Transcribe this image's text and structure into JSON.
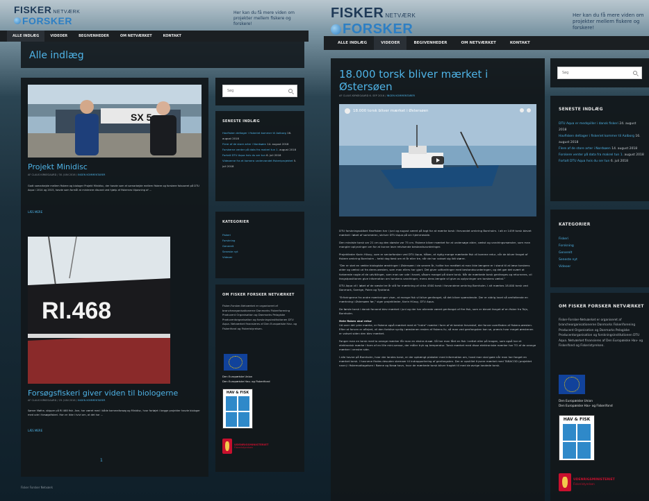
{
  "site": {
    "logo_line1": "FISKER",
    "logo_netvaerk": "NETVÆRK",
    "logo_line2": "FORSKER",
    "tagline": "Her kan du få mere viden om projekter mellem fiskere og forskere!"
  },
  "nav": {
    "items": [
      "ALLE INDLÆG",
      "VIDEOER",
      "BEGIVENHEDER",
      "OM NETVÆRKET",
      "KONTAKT"
    ]
  },
  "left": {
    "page_title": "Alle indlæg",
    "posts": [
      {
        "title": "Projekt Minidisc",
        "meta_prefix": "AF CLAUS KIRKEGAARD / 30. JUNI 2016 /",
        "meta_link": "INGEN KOMMENTARER",
        "excerpt": "Godt samarbejde mellem fiskere og biologer Projekt Minidisc, der havde som et samarbejde mellem fiskere og forskere fokuseret på DTU Aqua i 2014 og 2015, havde som formål at minimere discard ved hjælp af fiskernes tilpasning af ...",
        "read_more": "LÆS MERE",
        "boat_text": "SX 5"
      },
      {
        "title": "Forsøgsfiskeri giver viden til biologerne",
        "meta_prefix": "AF CLAUS KIRKEGAARD / 29. JUNI 2016 /",
        "meta_link": "INGEN KOMMENTARER",
        "excerpt": "Sørner Mølhe, skipper på RI 468 fish. Ane, har været med i både kameraforsøg og Minidisc, hvor fartøjet i begge projekter havde biologer med ude i forsøgsfiskeri. Han er ikke i tvivl om, at det har ...",
        "read_more": "LÆS MERE",
        "boat_text": "RI.468"
      }
    ],
    "pager": "1",
    "footer": "Fisker Forsker Netværk"
  },
  "sidebar": {
    "search_placeholder": "Søg",
    "recent_title": "SENESTE INDLÆG",
    "recent_posts": [
      {
        "link": "Havfisken deltager i fiskeriet kommer til Aalborg",
        "date": "16. august 2018"
      },
      {
        "link": "Flere af de store arter i Nordsøen",
        "date": "14. august 2018"
      },
      {
        "link": "Forskerne venter på data fra makrel tun 1.",
        "date": "august 2018"
      },
      {
        "link": "Fortalt DTU Aqua hvis du ser tun",
        "date": "6. juli 2018"
      },
      {
        "link": "Videoerne fra et kamera undervandet fiskeriprojektet",
        "date": "5. juli 2018"
      }
    ],
    "recent_posts_right": [
      {
        "link": "DTU Aqua er medspiller i dansk fiskeri",
        "date": "24. august 2018"
      },
      {
        "link": "Havfisken deltager i fiskeriet kommer til Aalborg",
        "date": "16. august 2018"
      },
      {
        "link": "Flere af de store arter i Nordsøen",
        "date": "14. august 2018"
      },
      {
        "link": "Forskere venter på data fra makrel tun 1.",
        "date": "august 2018"
      },
      {
        "link": "Fortalt DTU Aqua hvis du ser tun",
        "date": "6. juli 2018"
      }
    ],
    "cat_title": "KATEGORIER",
    "categories": [
      "Fiskeri",
      "Forskning",
      "Generelt",
      "Seneste nyt",
      "Videoer"
    ],
    "about_title": "OM FISKER FORSKER NETVÆRKET",
    "about_text": "Fisker-Forsker-Netværket er organiseret af brancheorganisationerne Danmarks Fiskeriforening Producent Organisation og Danmarks Pelagiske Producentorganisation og forskningsinstitutionen DTU Aqua. Netværket finansieres af Den Europæiske Hav- og Fiskerifond og Fiskeristyrelsen.",
    "eu_line1": "Den Europæiske Union",
    "eu_line2": "Den Europæiske Hav- og Fiskerifond",
    "hav_title": "HAV & FISK",
    "ministry_title": "UDENRIGSMINISTERIET",
    "ministry_sub": "Fiskeristyrelsen"
  },
  "article": {
    "title": "18.000 torsk bliver mærket i Østersøen",
    "meta_prefix": "AF CLAUS KIRKEGAARD 6. SEP 2016 /",
    "meta_link": "INGEN KOMMENTARER",
    "video_title": "18.000 torsk bliver mærket i Østersøen",
    "paragraphs": [
      "DTU forskningsskibet Havfisken har i juni og august været på togt for at mærke torsk i farvandet omkring Bornholm. I alt er 1459 torsk blevet mærket i løbet af sommeren, skriver DTU Aqua på sin hjemmeside.",
      "Den mindste torsk var 21 cm og den største var 75 cm. Fiskene bliver mærket for at undersøge alder, vækst og vandringsmønster, som man mangler oplysninger om for at kunne lave retvisende bestandsvurderinger.",
      "Projektleder Karin Hüssy, som er seniorforsker ved DTU Aqua, håber, at rigtig mange mærkede fisk vil komme retur, når de bliver fanget af fiskere omkring Bornholm – helst dog først om et år eller tre, når de har vokset sig lidt større.",
      "\"Der er sket en række biologiske ændringer i Østersøen i de senere år, hvilke har medført at man ikke længere er i stand til at læse torskens alder og vækst ud fra deres øresten, som man ellers har gjort. Det giver udfordringer med bestandsvurderingen, og det gør det svært at forberede nogle af de udviklinger, som man ser ude i havet, såsom mangel på store torsk. Når de mærkede torsk genfanges og returneres, vil fangstpositionen give information om torskens vandringer, mens dens længde vil give os oplysninger om torskens vækst.\"",
      "DTU Aqua vil i løbet af de næste tre år stå for mærkning af cirka 4500 torsk i farvandene omkring Bornholm. I alt mærkes 18.000 torsk ved Danmark, Sverige, Polen og Tyskland.",
      "\"Erfaringerne fra andre mærkninger viser, at mange fisk vil blive genfanget, så det bliver spændende. Der er aldrig lavet så omfattende en mærkning i Østersøen før,\" siger projektleder, Karin Hüssy, DTU Aqua.",
      "De første torsk i dansk farvand blev mærket i juni og der har allerede været genfangst af fire fisk, som er blevet fanget af en fisker fra Tejn, Bornholm."
    ],
    "subhead": "Hele fisken skal retur",
    "paragraphs2": [
      "Ud over det ydre mærke, er fiskene også mærket med et \"indre\" mærke i form af et kemisk farvestof, der farver overfladen af fiskens øresten. Efter at farven er aflejret, vil den forblive synlig i ørestenen resten af fiskens liv, så man ved genfangsten kan se, præcis hvor meget ørestenen er vokset siden den blev mærket.",
      "Fanger man en torsk med to orange mærker får man en ekstra dusør. Så har man fået en fisk i nettet eller på krogen, som også har et elektronisk mærke i form af en lille mini-sensor, der måler tryk og temperatur. Torsk mærket med disse elektroniske mærker har TO af de orange mærker i venstre side.",
      "I alle havne på Bornholm, hvor der landes torsk, er der ophængt plakater med information om, hvad man skal gøre når man har fanget en mærket torsk. I havnene findes desuden skemaer til indrapportering af genfangsten. Der er opstillet frysere mærket med TABACOD (projektet navn) i fiskemodtagelsen i Rønne og Nexø havn, hvor de mærkede torsk bliver fragtet til med de øvrige landede torsk."
    ]
  },
  "colors": {
    "accent": "#4fb3e6",
    "panel": "#12171b",
    "nav": "#1b1f22"
  }
}
